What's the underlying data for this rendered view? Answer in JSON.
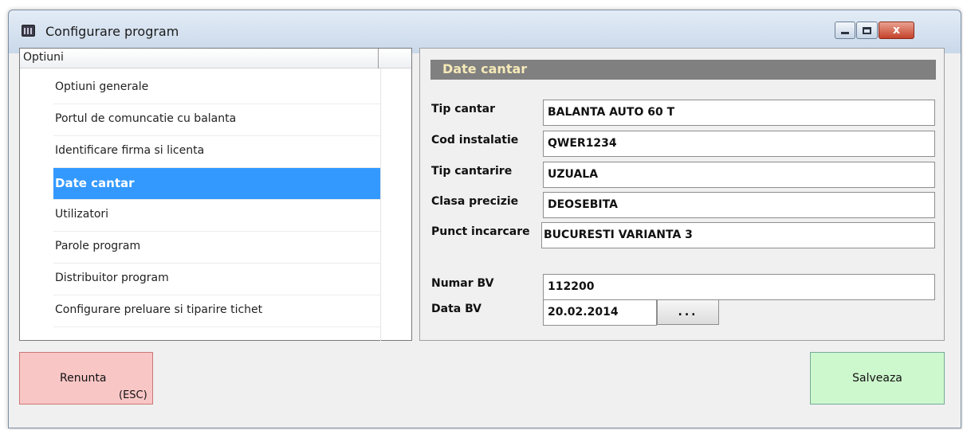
{
  "window": {
    "title": "Configurare program"
  },
  "options_list": {
    "header": "Optiuni",
    "items": [
      {
        "label": "Optiuni generale",
        "selected": false
      },
      {
        "label": "Portul de comuncatie cu balanta",
        "selected": false
      },
      {
        "label": "Identificare firma si licenta",
        "selected": false
      },
      {
        "label": "Date cantar",
        "selected": true
      },
      {
        "label": "Utilizatori",
        "selected": false
      },
      {
        "label": "Parole program",
        "selected": false
      },
      {
        "label": "Distribuitor program",
        "selected": false
      },
      {
        "label": "Configurare preluare si tiparire tichet",
        "selected": false
      }
    ]
  },
  "section": {
    "title": "Date cantar",
    "fields": [
      {
        "label": "Tip cantar",
        "value": "BALANTA AUTO 60 T"
      },
      {
        "label": "Cod instalatie",
        "value": "QWER1234"
      },
      {
        "label": "Tip cantarire",
        "value": "UZUALA"
      },
      {
        "label": "Clasa precizie",
        "value": "DEOSEBITA"
      },
      {
        "label": "Punct incarcare",
        "value": "BUCURESTI VARIANTA 3"
      },
      {
        "label": "Numar BV",
        "value": "112200"
      },
      {
        "label": "Data BV",
        "value": "20.02.2014"
      }
    ],
    "date_picker_label": "..."
  },
  "buttons": {
    "cancel_label": "Renunta",
    "cancel_hint": "(ESC)",
    "save_label": "Salveaza",
    "close_glyph": "x"
  },
  "colors": {
    "selection": "#3399ff",
    "section_header_bg": "#808080",
    "section_header_text": "#f5e9b8",
    "cancel_bg": "#f9c6c6",
    "save_bg": "#cdf7cd"
  }
}
